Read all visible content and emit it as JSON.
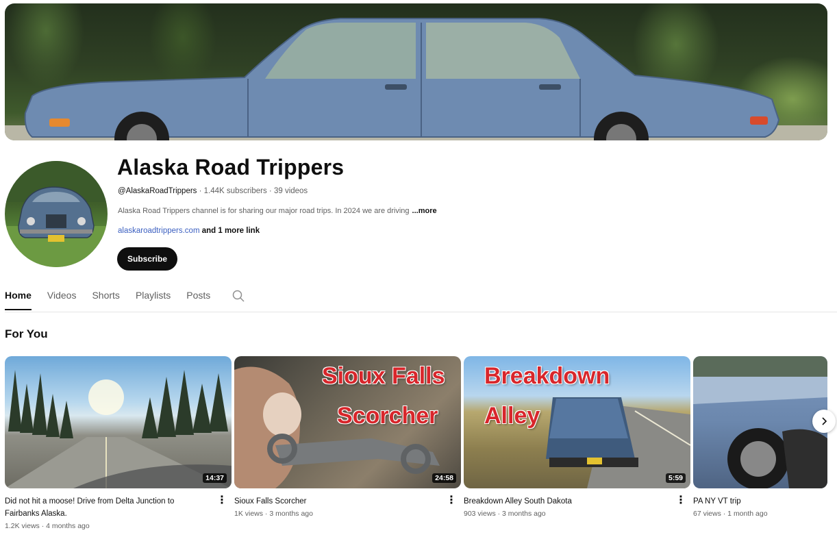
{
  "channel": {
    "name": "Alaska Road Trippers",
    "handle": "@AlaskaRoadTrippers",
    "subscribers": "1.44K subscribers",
    "videos": "39 videos",
    "separator": " · ",
    "description": "Alaska Road Trippers channel is for sharing our major road trips.  In 2024 we are driving",
    "description_more": "...more",
    "link": "alaskaroadtrippers.com",
    "more_links": " and 1 more link",
    "subscribe_label": "Subscribe"
  },
  "tabs": [
    {
      "label": "Home",
      "active": true
    },
    {
      "label": "Videos",
      "active": false
    },
    {
      "label": "Shorts",
      "active": false
    },
    {
      "label": "Playlists",
      "active": false
    },
    {
      "label": "Posts",
      "active": false
    }
  ],
  "section": {
    "title": "For You"
  },
  "videos": [
    {
      "title": "Did not hit a moose! Drive from Delta Junction to Fairbanks Alaska.",
      "duration": "14:37",
      "meta": "1.2K views · 4 months ago"
    },
    {
      "title": "Sioux Falls Scorcher",
      "duration": "24:58",
      "meta": "1K views · 3 months ago",
      "overlay": [
        "Sioux Falls",
        "Scorcher"
      ]
    },
    {
      "title": "Breakdown Alley South Dakota",
      "duration": "5:59",
      "meta": "903 views · 3 months ago",
      "overlay": [
        "Breakdown",
        "Alley"
      ]
    },
    {
      "title": "PA NY VT trip",
      "duration": "",
      "meta": "67 views · 1 month ago"
    }
  ],
  "icons": {
    "search": "search-icon",
    "kebab": "more-vert-icon",
    "next": "chevron-right-icon",
    "kebab_glyph": "⋮"
  },
  "colors": {
    "subscribe_bg": "#0f0f0f",
    "link": "#3b5fc0",
    "overlay_text": "#d8262b"
  }
}
